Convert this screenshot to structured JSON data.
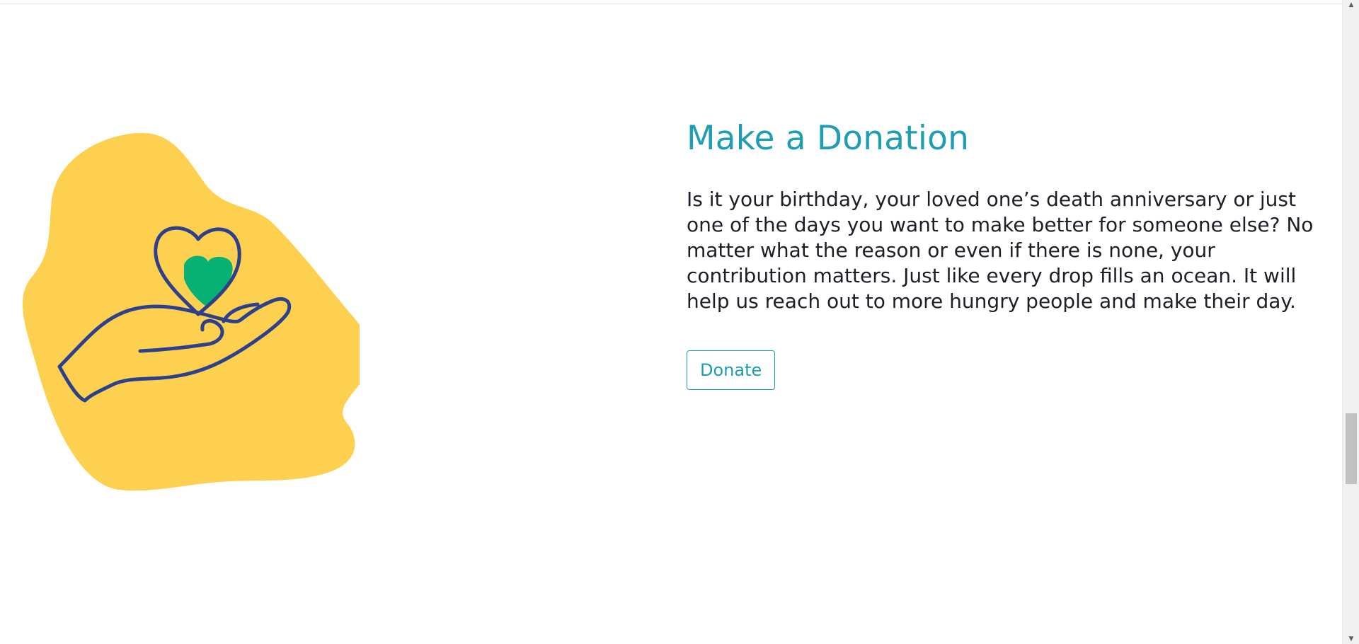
{
  "section": {
    "title": "Make a Donation",
    "body": "Is it your birthday, your loved one’s death anniversary or just one of the days you want to make better for someone else? No matter what the reason or even if there is none, your contribution matters. Just like every drop fills an ocean. It will help us reach out to more hungry people and make their day.",
    "donate_label": "Donate"
  },
  "illustration": {
    "icon": "hand-holding-heart-icon",
    "colors": {
      "blob": "#fdd14f",
      "outline": "#2e3f8b",
      "heart_fill": "#06b173"
    }
  },
  "theme": {
    "accent": "#1e9db3",
    "text": "#1e1e28",
    "background": "#ffffff"
  },
  "scrollbar": {
    "up_arrow": "▲",
    "down_arrow": "▼"
  }
}
